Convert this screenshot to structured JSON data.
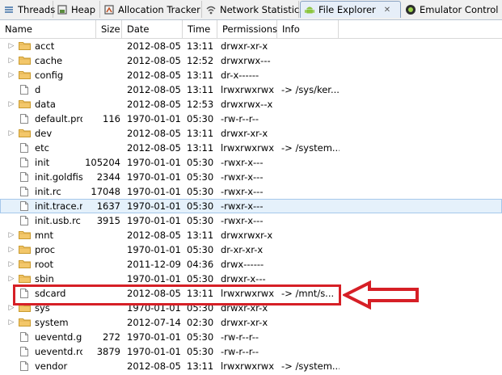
{
  "tabs": [
    {
      "label": "Threads",
      "icon": "threads-icon"
    },
    {
      "label": "Heap",
      "icon": "heap-icon"
    },
    {
      "label": "Allocation Tracker",
      "icon": "allocation-tracker-icon"
    },
    {
      "label": "Network Statistics",
      "icon": "network-statistics-icon"
    },
    {
      "label": "File Explorer",
      "icon": "android-icon",
      "active": true
    },
    {
      "label": "Emulator Control",
      "icon": "emulator-control-icon"
    }
  ],
  "columns": {
    "name": "Name",
    "size": "Size",
    "date": "Date",
    "time": "Time",
    "permissions": "Permissions",
    "info": "Info"
  },
  "rows": [
    {
      "type": "folder",
      "name": "acct",
      "size": "",
      "date": "2012-08-05",
      "time": "13:11",
      "perm": "drwxr-xr-x",
      "info": ""
    },
    {
      "type": "folder",
      "name": "cache",
      "size": "",
      "date": "2012-08-05",
      "time": "12:52",
      "perm": "drwxrwx---",
      "info": ""
    },
    {
      "type": "folder",
      "name": "config",
      "size": "",
      "date": "2012-08-05",
      "time": "13:11",
      "perm": "dr-x------",
      "info": ""
    },
    {
      "type": "file",
      "name": "d",
      "size": "",
      "date": "2012-08-05",
      "time": "13:11",
      "perm": "lrwxrwxrwx",
      "info": "-> /sys/ker..."
    },
    {
      "type": "folder",
      "name": "data",
      "size": "",
      "date": "2012-08-05",
      "time": "12:53",
      "perm": "drwxrwx--x",
      "info": ""
    },
    {
      "type": "file",
      "name": "default.pro",
      "size": "116",
      "date": "1970-01-01",
      "time": "05:30",
      "perm": "-rw-r--r--",
      "info": ""
    },
    {
      "type": "folder",
      "name": "dev",
      "size": "",
      "date": "2012-08-05",
      "time": "13:11",
      "perm": "drwxr-xr-x",
      "info": ""
    },
    {
      "type": "file",
      "name": "etc",
      "size": "",
      "date": "2012-08-05",
      "time": "13:11",
      "perm": "lrwxrwxrwx",
      "info": "-> /system..."
    },
    {
      "type": "file",
      "name": "init",
      "size": "105204",
      "date": "1970-01-01",
      "time": "05:30",
      "perm": "-rwxr-x---",
      "info": ""
    },
    {
      "type": "file",
      "name": "init.goldfis",
      "size": "2344",
      "date": "1970-01-01",
      "time": "05:30",
      "perm": "-rwxr-x---",
      "info": ""
    },
    {
      "type": "file",
      "name": "init.rc",
      "size": "17048",
      "date": "1970-01-01",
      "time": "05:30",
      "perm": "-rwxr-x---",
      "info": ""
    },
    {
      "type": "file",
      "name": "init.trace.rc",
      "size": "1637",
      "date": "1970-01-01",
      "time": "05:30",
      "perm": "-rwxr-x---",
      "info": "",
      "selected": true
    },
    {
      "type": "file",
      "name": "init.usb.rc",
      "size": "3915",
      "date": "1970-01-01",
      "time": "05:30",
      "perm": "-rwxr-x---",
      "info": ""
    },
    {
      "type": "folder",
      "name": "mnt",
      "size": "",
      "date": "2012-08-05",
      "time": "13:11",
      "perm": "drwxrwxr-x",
      "info": ""
    },
    {
      "type": "folder",
      "name": "proc",
      "size": "",
      "date": "1970-01-01",
      "time": "05:30",
      "perm": "dr-xr-xr-x",
      "info": ""
    },
    {
      "type": "folder",
      "name": "root",
      "size": "",
      "date": "2011-12-09",
      "time": "04:36",
      "perm": "drwx------",
      "info": ""
    },
    {
      "type": "folder",
      "name": "sbin",
      "size": "",
      "date": "1970-01-01",
      "time": "05:30",
      "perm": "drwxr-x---",
      "info": ""
    },
    {
      "type": "file",
      "name": "sdcard",
      "size": "",
      "date": "2012-08-05",
      "time": "13:11",
      "perm": "lrwxrwxrwx",
      "info": "-> /mnt/s..."
    },
    {
      "type": "folder",
      "name": "sys",
      "size": "",
      "date": "1970-01-01",
      "time": "05:30",
      "perm": "drwxr-xr-x",
      "info": ""
    },
    {
      "type": "folder",
      "name": "system",
      "size": "",
      "date": "2012-07-14",
      "time": "02:30",
      "perm": "drwxr-xr-x",
      "info": ""
    },
    {
      "type": "file",
      "name": "ueventd.gc",
      "size": "272",
      "date": "1970-01-01",
      "time": "05:30",
      "perm": "-rw-r--r--",
      "info": ""
    },
    {
      "type": "file",
      "name": "ueventd.rc",
      "size": "3879",
      "date": "1970-01-01",
      "time": "05:30",
      "perm": "-rw-r--r--",
      "info": ""
    },
    {
      "type": "file",
      "name": "vendor",
      "size": "",
      "date": "2012-08-05",
      "time": "13:11",
      "perm": "lrwxrwxrwx",
      "info": "-> /system..."
    }
  ],
  "annotation": {
    "color": "#d61f26",
    "target": "sdcard"
  }
}
